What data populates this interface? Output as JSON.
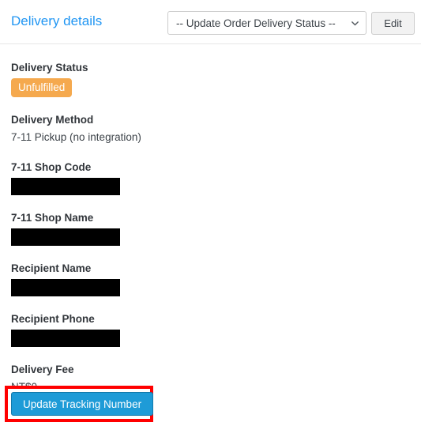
{
  "header": {
    "title": "Delivery details",
    "status_select": {
      "selected": "-- Update Order Delivery Status --",
      "icon": "chevron-down-icon"
    },
    "edit_label": "Edit"
  },
  "fields": [
    {
      "label": "Delivery Status",
      "type": "badge",
      "value": "Unfulfilled"
    },
    {
      "label": "Delivery Method",
      "type": "text",
      "value": "7-11 Pickup (no integration)"
    },
    {
      "label": "7-11 Shop Code",
      "type": "redacted",
      "value": ""
    },
    {
      "label": "7-11 Shop Name",
      "type": "redacted",
      "value": ""
    },
    {
      "label": "Recipient Name",
      "type": "redacted",
      "value": ""
    },
    {
      "label": "Recipient Phone",
      "type": "redacted",
      "value": ""
    },
    {
      "label": "Delivery Fee",
      "type": "text",
      "value": "NT$0"
    }
  ],
  "action": {
    "update_tracking_label": "Update Tracking Number"
  },
  "colors": {
    "title_link": "#2196f3",
    "badge_unfulfilled": "#f5a94e",
    "primary_button": "#1e9bd7",
    "primary_button_border": "#1279ab",
    "highlight_outline": "#ff0000",
    "label_text": "#32363b",
    "divider": "#e6e6e6",
    "redaction": "#000000"
  }
}
